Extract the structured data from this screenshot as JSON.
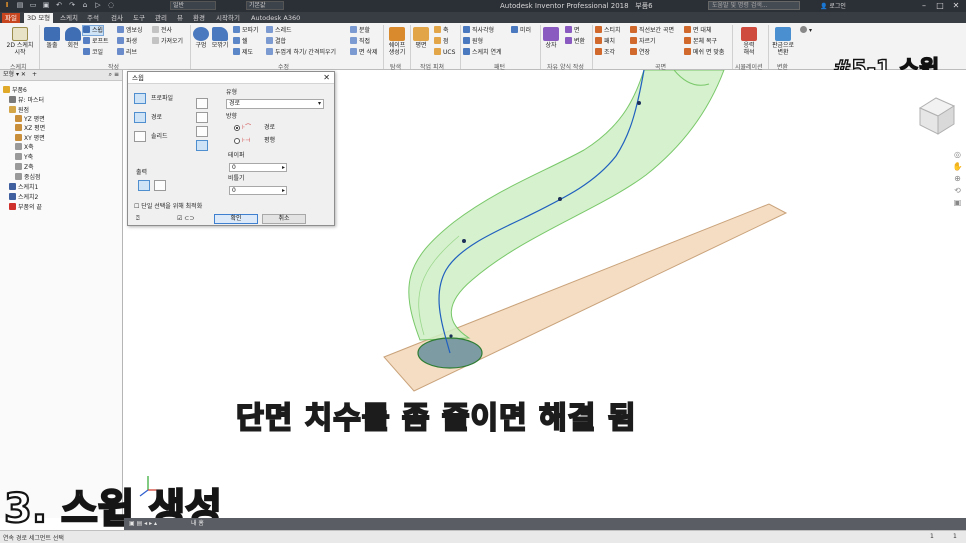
{
  "titlebar": {
    "general": "일반",
    "material": "기본값",
    "app_title": "Autodesk Inventor Professional 2018",
    "doc_name": "부품6",
    "search_placeholder": "도움말 및 명령 검색...",
    "login": "로그인"
  },
  "menu_tabs": [
    "파일",
    "3D 모형",
    "스케치",
    "주석",
    "검사",
    "도구",
    "관리",
    "뷰",
    "환경",
    "시작하기",
    "Autodesk A360"
  ],
  "ribbon": {
    "sketch_btn": "2D 스케치\n시작",
    "sketch_group": "스케치",
    "extrude": "돌출",
    "revolve": "회전",
    "sweep": "스윕",
    "loft": "로프트",
    "coil": "코일",
    "emboss": "엠보싱",
    "rib": "리브",
    "decal": "전사",
    "derive": "파생",
    "import": "가져오기",
    "create_group": "작성",
    "hole": "구멍",
    "fillet": "모깎기",
    "chamfer": "모따기",
    "shell": "쉘",
    "draft": "제도",
    "thread": "스레드",
    "combine": "결합",
    "thicken": "두껍게 하기/ 간격띄우기",
    "split": "분할",
    "direct": "직접",
    "delete_face": "면 삭제",
    "modify_group": "수정",
    "shape_gen": "쉐이프\n생성기",
    "explore_group": "탐색",
    "plane": "평면",
    "axis": "축",
    "point": "점",
    "ucs": "UCS",
    "work_group": "작업 피쳐",
    "rect_pattern": "직사각형",
    "circ_pattern": "원형",
    "sketch_pattern": "스케치 연계",
    "mirror": "미러",
    "pattern_group": "패턴",
    "box": "상자",
    "face": "면",
    "convert": "변환",
    "freeform_group": "자유 양식 작성",
    "stitch": "스티치",
    "patch": "패치",
    "sculpt": "조각",
    "ruled": "직선보간 곡면",
    "trim": "자르기",
    "extend": "연장",
    "replace_face": "면 대체",
    "repair": "본체 복구",
    "mesh_fit": "메쉬 면 맞춤",
    "surface_group": "곡면",
    "stress": "응력\n해석",
    "sim_group": "시뮬레이션",
    "convert_sheet": "판금으로\n변환",
    "convert_group": "변환",
    "episode_title": "#5-1 스윕"
  },
  "browser": {
    "tab": "모형",
    "items": [
      {
        "label": "부품6",
        "level": 0,
        "icon": "part-icon",
        "color": "#e0a92a"
      },
      {
        "label": "뷰: 마스터",
        "level": 1,
        "icon": "view-icon",
        "color": "#7a7a7a"
      },
      {
        "label": "원점",
        "level": 1,
        "icon": "folder-icon",
        "color": "#d4a64a"
      },
      {
        "label": "YZ 평면",
        "level": 2,
        "icon": "plane-icon",
        "color": "#c98f3a"
      },
      {
        "label": "XZ 평면",
        "level": 2,
        "icon": "plane-icon",
        "color": "#c98f3a"
      },
      {
        "label": "XY 평면",
        "level": 2,
        "icon": "plane-icon",
        "color": "#c98f3a"
      },
      {
        "label": "X축",
        "level": 2,
        "icon": "axis-icon",
        "color": "#9a9a9a"
      },
      {
        "label": "Y축",
        "level": 2,
        "icon": "axis-icon",
        "color": "#9a9a9a"
      },
      {
        "label": "Z축",
        "level": 2,
        "icon": "axis-icon",
        "color": "#9a9a9a"
      },
      {
        "label": "중심점",
        "level": 2,
        "icon": "point-icon",
        "color": "#9a9a9a"
      },
      {
        "label": "스케치1",
        "level": 1,
        "icon": "sketch-icon",
        "color": "#3f5f9f"
      },
      {
        "label": "스케치2",
        "level": 1,
        "icon": "sketch-icon",
        "color": "#3f5f9f"
      },
      {
        "label": "부품의 끝",
        "level": 1,
        "icon": "end-of-part-icon",
        "color": "#d0302c"
      }
    ]
  },
  "dialog": {
    "title": "스윕",
    "profile": "프로파일",
    "path": "경로",
    "solid": "솔리드",
    "output": "출력",
    "type_label": "유형",
    "type_value": "경로",
    "direction_label": "방향",
    "dir_path": "경로",
    "dir_parallel": "평행",
    "taper_label": "테이퍼",
    "taper_value": "0",
    "twist_label": "비틀기",
    "twist_value": "0",
    "optimize": "단일 선택을 위해 최적화",
    "ok": "확인",
    "cancel": "취소"
  },
  "captions": {
    "main": "단면 치수를 좀 줄이면 해결 됨",
    "step": "3. 스윕 생성"
  },
  "doc_tabs": [
    "내 홈"
  ],
  "status": {
    "text": "연속 경로 세그먼트 선택",
    "page_a": "1",
    "page_b": "1"
  },
  "colors": {
    "file_tab": "#c8461f",
    "sweep_fill": "#cfeec4",
    "path_line": "#1f5fbf",
    "plane_fill": "#f4ddc3",
    "caption_yellow": "#ffee22"
  }
}
